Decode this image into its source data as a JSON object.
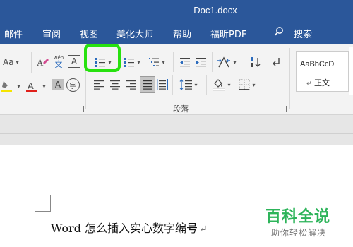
{
  "window": {
    "title": "Doc1.docx"
  },
  "tabs": [
    {
      "label": "邮件"
    },
    {
      "label": "审阅"
    },
    {
      "label": "视图"
    },
    {
      "label": "美化大师"
    },
    {
      "label": "帮助"
    },
    {
      "label": "福昕PDF"
    },
    {
      "label": "搜索"
    }
  ],
  "ribbon": {
    "font": {
      "aa_label": "Aa",
      "wen_top": "wén",
      "wen_bottom": "文",
      "char_border": "A",
      "shading": "A",
      "circle": "字"
    },
    "paragraph_group_label": "段落",
    "styles": {
      "preview": "AaBbCcD",
      "name": "正文",
      "pilcrow": "↵"
    }
  },
  "document": {
    "text": "Word 怎么插入实心数字编号",
    "pilcrow": "↵"
  },
  "watermark": {
    "brand": "百科全说",
    "slogan": "助你轻松解决"
  },
  "colors": {
    "accent": "#2b579a",
    "highlight_frame": "#27e10f",
    "watermark": "#2db45a",
    "font_color": "#e0201a",
    "highlight_color": "#f5e400"
  }
}
